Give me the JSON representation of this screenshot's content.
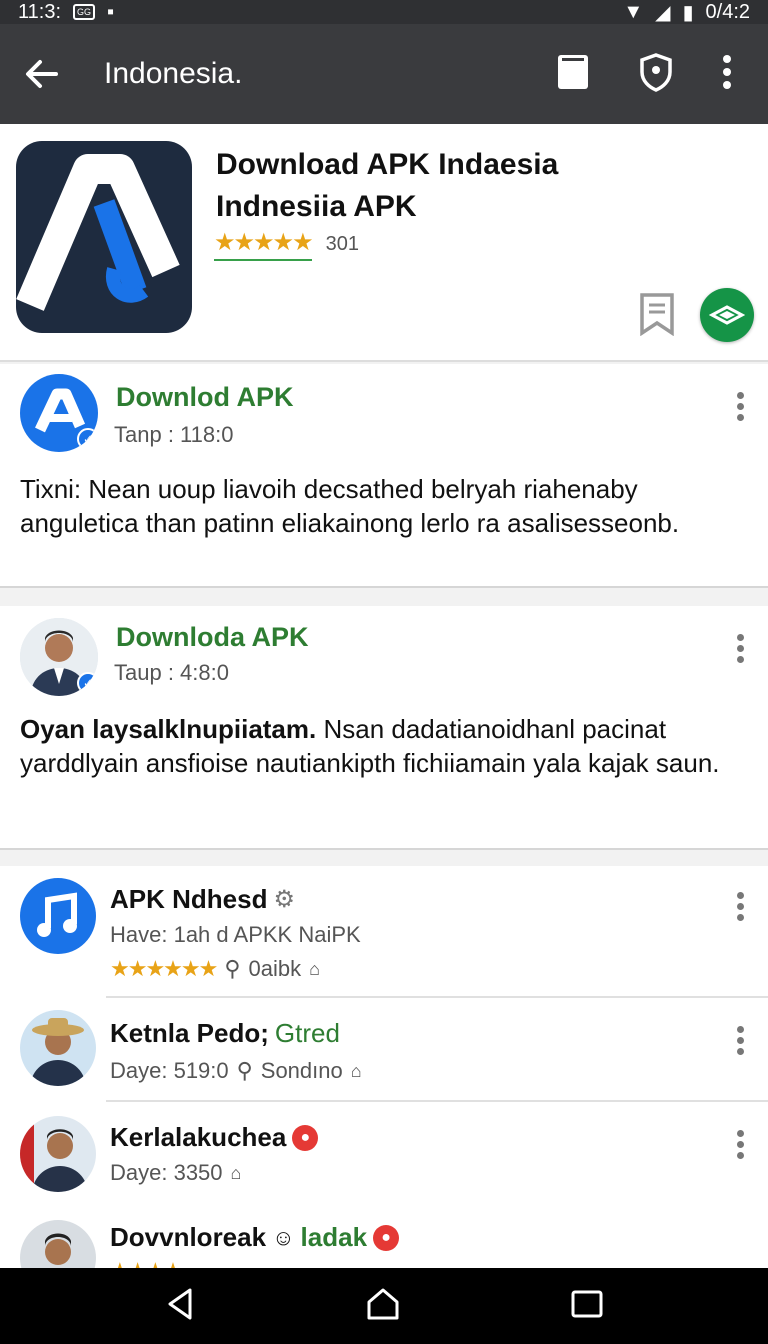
{
  "status_bar": {
    "time": "11:3:",
    "right_text": "0/4:2"
  },
  "app_bar": {
    "title": "Indonesia."
  },
  "header": {
    "title_line1": "Download APK Indaesia",
    "title_line2": "Indnesiia APK",
    "rating_count": "301",
    "stars": "★★★★★"
  },
  "posts": [
    {
      "name": "Downlod APK",
      "meta": "Tanp : 118:0",
      "body": "Tixni: Nean uoup liavoih decsathed belryah riahenaby anguletica than patinn eliakainong lerlo ra asalisesseonb."
    },
    {
      "name": "Downloda APK",
      "meta": "Taup : 4:8:0",
      "body_bold": "Oyan laysalklnupiiatam.",
      "body_rest": " Nsan dadatianoidhanl pacinat yarddlyain ansfioise nautiankipth fichiiamain yala kajak saun."
    }
  ],
  "list": [
    {
      "name": "APK Ndhesd",
      "meta": "Have: 1ah d APKK NaiPK",
      "stars": "★★★★★★",
      "rating_text": "0aibk"
    },
    {
      "name_black": "Ketnla Pedo;",
      "name_green": "Gtred",
      "meta": "Daye: 519:0",
      "meta2": "Sondıno"
    },
    {
      "name": "Kerlalakuchea",
      "meta": "Daye: 3350"
    },
    {
      "name_black": "Dovvnloreak",
      "name_green": "ladak"
    }
  ],
  "colors": {
    "accent_green": "#2e7d32",
    "app_bar": "#3a3b3e",
    "star": "#e8a317",
    "brand_blue": "#1a73e8"
  }
}
